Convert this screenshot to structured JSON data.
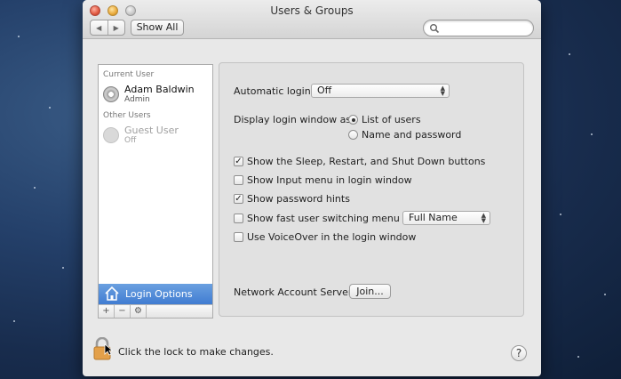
{
  "window": {
    "title": "Users & Groups",
    "show_all_label": "Show All",
    "search_placeholder": ""
  },
  "sidebar": {
    "current_user_heading": "Current User",
    "current_user": {
      "name": "Adam Baldwin",
      "role": "Admin"
    },
    "other_users_heading": "Other Users",
    "other_users": [
      {
        "name": "Guest User",
        "role": "Off"
      }
    ],
    "login_options_label": "Login Options",
    "toolbar": {
      "add": "+",
      "remove": "−",
      "action": "⚙"
    }
  },
  "login": {
    "automatic_login_label": "Automatic login:",
    "automatic_login_value": "Off",
    "display_as_label": "Display login window as:",
    "display_options": [
      {
        "label": "List of users",
        "selected": true
      },
      {
        "label": "Name and password",
        "selected": false
      }
    ],
    "checkboxes": [
      {
        "label": "Show the Sleep, Restart, and Shut Down buttons",
        "checked": true
      },
      {
        "label": "Show Input menu in login window",
        "checked": false
      },
      {
        "label": "Show password hints",
        "checked": true
      },
      {
        "label": "Show fast user switching menu as",
        "checked": false
      },
      {
        "label": "Use VoiceOver in the login window",
        "checked": false
      }
    ],
    "fast_switch_value": "Full Name",
    "network_server_label": "Network Account Server:",
    "join_label": "Join..."
  },
  "footer": {
    "lock_text": "Click the lock to make changes.",
    "help_label": "?"
  }
}
